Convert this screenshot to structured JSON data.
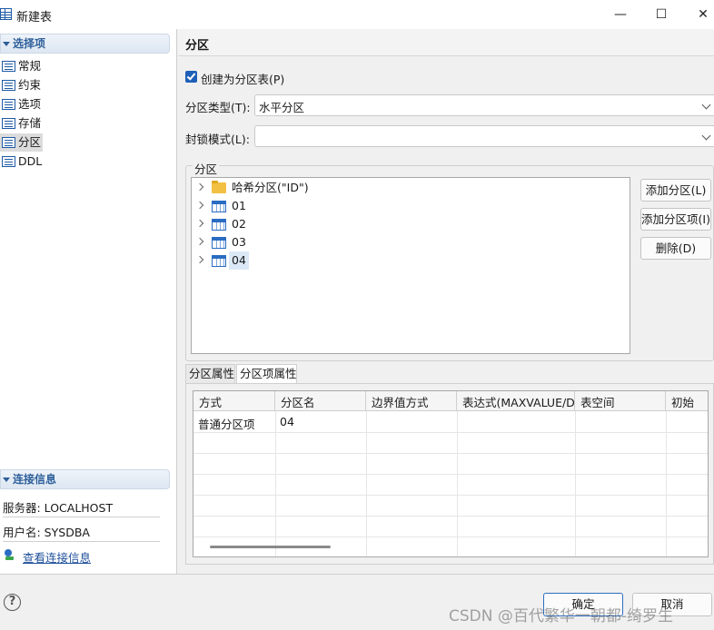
{
  "window": {
    "title": "新建表",
    "minimize": "—",
    "maximize": "☐",
    "close": "✕"
  },
  "sidebar": {
    "section_title": "选择项",
    "items": [
      {
        "label": "常规"
      },
      {
        "label": "约束"
      },
      {
        "label": "选项"
      },
      {
        "label": "存储"
      },
      {
        "label": "分区",
        "selected": true
      },
      {
        "label": "DDL"
      }
    ],
    "conn_title": "连接信息",
    "server": "服务器: LOCALHOST",
    "user": "用户名: SYSDBA",
    "view_conn": "查看连接信息"
  },
  "main": {
    "title": "分区",
    "create_partition_label": "创建为分区表(P)",
    "partition_type_label": "分区类型(T):",
    "partition_type_value": "水平分区",
    "lock_mode_label": "封锁模式(L):",
    "lock_mode_value": "",
    "group_label": "分区",
    "tree": [
      {
        "label": "哈希分区(\"ID\")",
        "icon": "folder-icon"
      },
      {
        "label": "01",
        "icon": "table-icon"
      },
      {
        "label": "02",
        "icon": "table-icon"
      },
      {
        "label": "03",
        "icon": "table-icon"
      },
      {
        "label": "04",
        "icon": "table-icon",
        "selected": true
      }
    ],
    "buttons": {
      "add_partition": "添加分区(L)",
      "add_partition_item": "添加分区项(I)",
      "delete": "删除(D)"
    },
    "tabs": [
      {
        "label": "分区属性"
      },
      {
        "label": "分区项属性",
        "active": true
      }
    ],
    "table": {
      "columns": [
        "方式",
        "分区名",
        "边界值方式",
        "表达式(MAXVALUE/DI",
        "表空间",
        "初始"
      ],
      "rows": [
        [
          "普通分区项",
          "04",
          "",
          "",
          "",
          ""
        ]
      ]
    }
  },
  "footer": {
    "help": "?",
    "ok": "确定",
    "cancel": "取消",
    "watermark": "CSDN @百代繁华一朝都-绮罗生"
  },
  "colors": {
    "accent": "#1e5fb8",
    "section_header": "#2d5f9a"
  }
}
